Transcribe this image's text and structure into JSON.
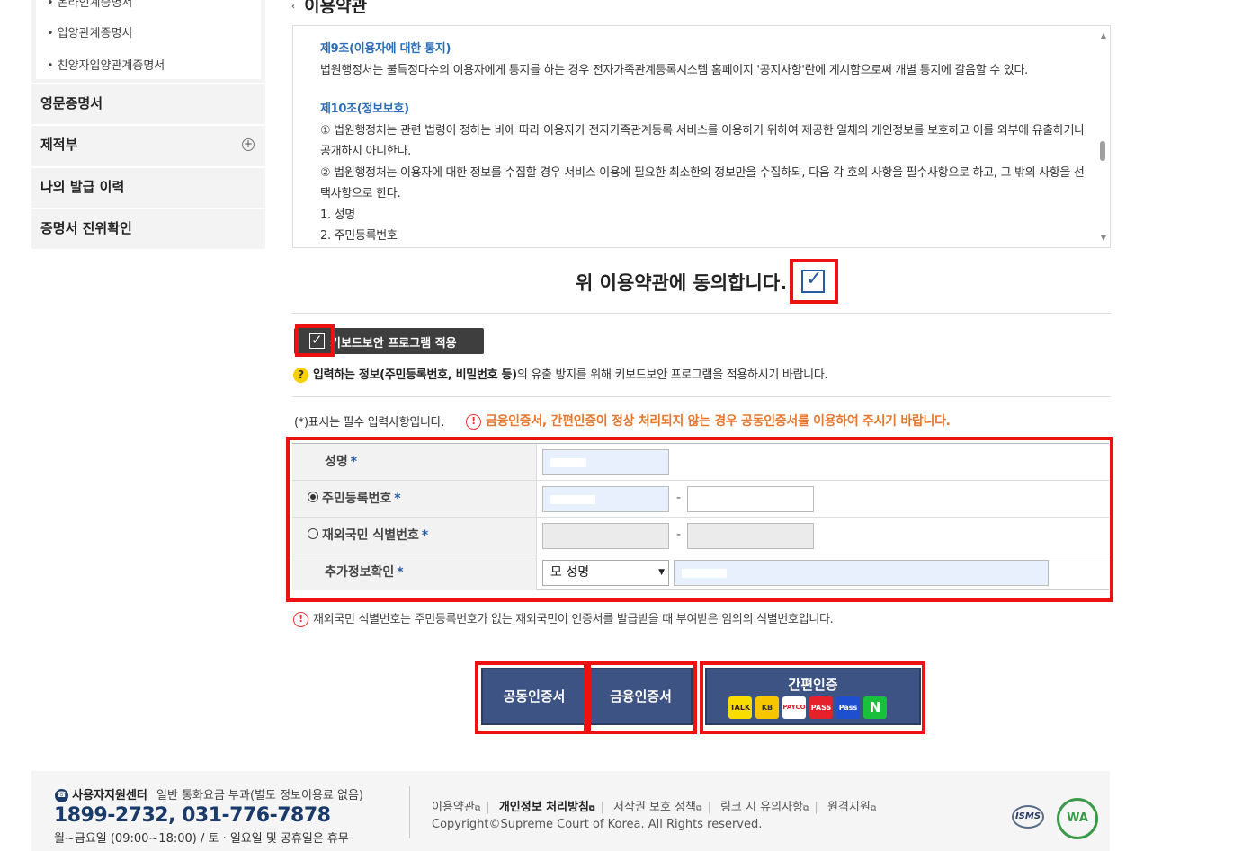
{
  "sidebar": {
    "sub_items": [
      "온라인계증명서",
      "입양관계증명서",
      "친양자입양관계증명서"
    ],
    "menus": [
      "영문증명서",
      "제적부",
      "나의 발급 이력",
      "증명서 진위확인"
    ]
  },
  "section_title": "이용약관",
  "terms": {
    "art9_title": "제9조(이용자에 대한 통지)",
    "art9_body": "법원행정처는 불특정다수의 이용자에게 통지를 하는 경우 전자가족관계등록시스템 홈페이지 '공지사항'란에 게시함으로써 개별 통지에 갈음할 수 있다.",
    "art10_title": "제10조(정보보호)",
    "art10_p1": "① 법원행정처는 관련 법령이 정하는 바에 따라 이용자가 전자가족관계등록 서비스를 이용하기 위하여 제공한 일체의 개인정보를 보호하고 이를 외부에 유출하거나 공개하지 아니한다.",
    "art10_p2": "② 법원행정처는 이용자에 대한 정보를 수집할 경우 서비스 이용에 필요한 최소한의 정보만을 수집하되, 다음 각 호의 사항을 필수사항으로 하고, 그 밖의 사항을 선택사항으로 한다.",
    "item1": "1. 성명",
    "item2": "2. 주민등록번호"
  },
  "agree_label": "위 이용약관에 동의합니다.",
  "keyboard": {
    "label": "키보드보안 프로그램 적용",
    "info_bold": "입력하는 정보(주민등록번호, 비밀번호 등)",
    "info_rest": "의 유출 방지를 위해 키보드보안 프로그램을 적용하시기 바랍니다."
  },
  "required_note": "(*)표시는 필수 입력사항입니다.",
  "warning_note": "금융인증서, 간편인증이 정상 처리되지 않는 경우 공동인증서를 이용하여 주시기 바랍니다.",
  "form": {
    "name_label": "성명",
    "rrn_label": "주민등록번호",
    "foreign_label": "재외국민 식별번호",
    "extra_label": "추가정보확인",
    "required_mark": "*",
    "extra_select": "모 성명",
    "dash": "-"
  },
  "foreign_note": "재외국민 식별번호는 주민등록번호가 없는 재외국민이 인증서를 발급받을 때 부여받은 임의의 식별번호입니다.",
  "buttons": {
    "joint_cert": "공동인증서",
    "financial_cert": "금융인증서",
    "simple_auth": "간편인증",
    "providers": [
      "TALK",
      "KB",
      "PAYCO",
      "PASS",
      "Pass",
      "N"
    ]
  },
  "footer": {
    "support_title": "사용자지원센터",
    "support_note": "일반 통화요금 부과(별도 정보이용료 없음)",
    "phone": "1899-2732, 031-776-7878",
    "hours": "월~금요일 (09:00~18:00) / 토 · 일요일 및 공휴일은 휴무",
    "links": [
      "이용약관",
      "개인정보 처리방침",
      "저작권 보호 정책",
      "링크 시 유의사항",
      "원격지원"
    ],
    "copyright": "Copyright©Supreme Court of Korea. All Rights reserved.",
    "badge1": "ISMS",
    "badge2": "WA"
  },
  "colors": {
    "accent_blue": "#2a5aa0",
    "button_navy": "#3d5383",
    "warning_orange": "#e8772e",
    "highlight_red": "#e11111"
  }
}
